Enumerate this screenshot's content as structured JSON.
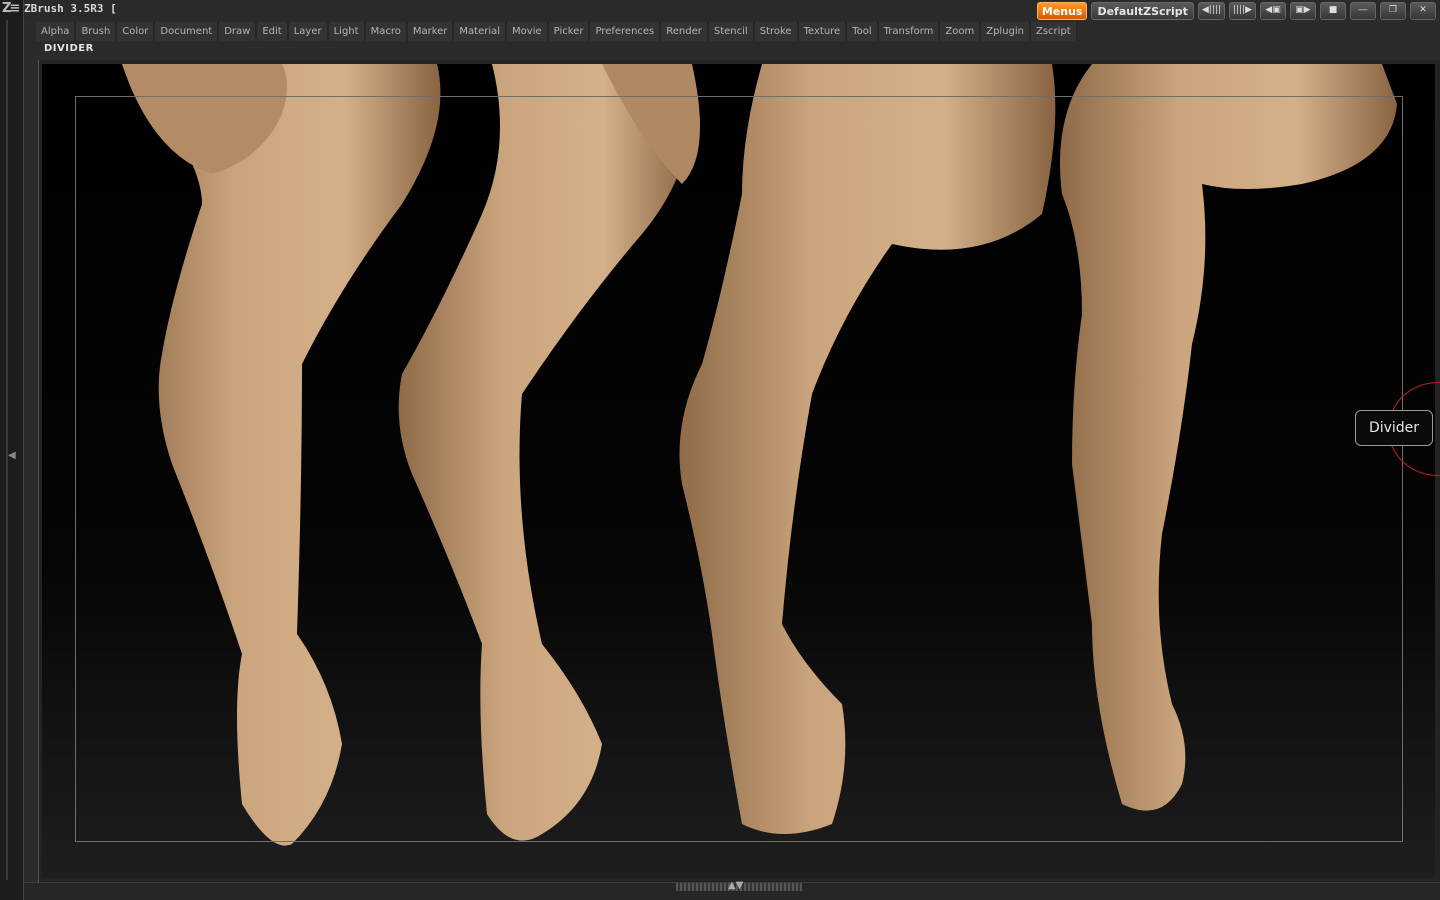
{
  "app": {
    "title": "ZBrush 3.5R3  [",
    "logo_icon": "zbrush-logo-icon"
  },
  "toolbar": {
    "menus_label": "Menus",
    "script_label": "DefaultZScript",
    "menus_color": "#e87410"
  },
  "menubar": {
    "items": [
      "Alpha",
      "Brush",
      "Color",
      "Document",
      "Draw",
      "Edit",
      "Layer",
      "Light",
      "Macro",
      "Marker",
      "Material",
      "Movie",
      "Picker",
      "Preferences",
      "Render",
      "Stencil",
      "Stroke",
      "Texture",
      "Tool",
      "Transform",
      "Zoom",
      "Zplugin",
      "Zscript"
    ]
  },
  "palette": {
    "title": "DIVIDER"
  },
  "tooltip": {
    "label": "Divider"
  },
  "canvas": {
    "content": "four-sculpted-arm-models",
    "skin_color": "#c49b72"
  }
}
